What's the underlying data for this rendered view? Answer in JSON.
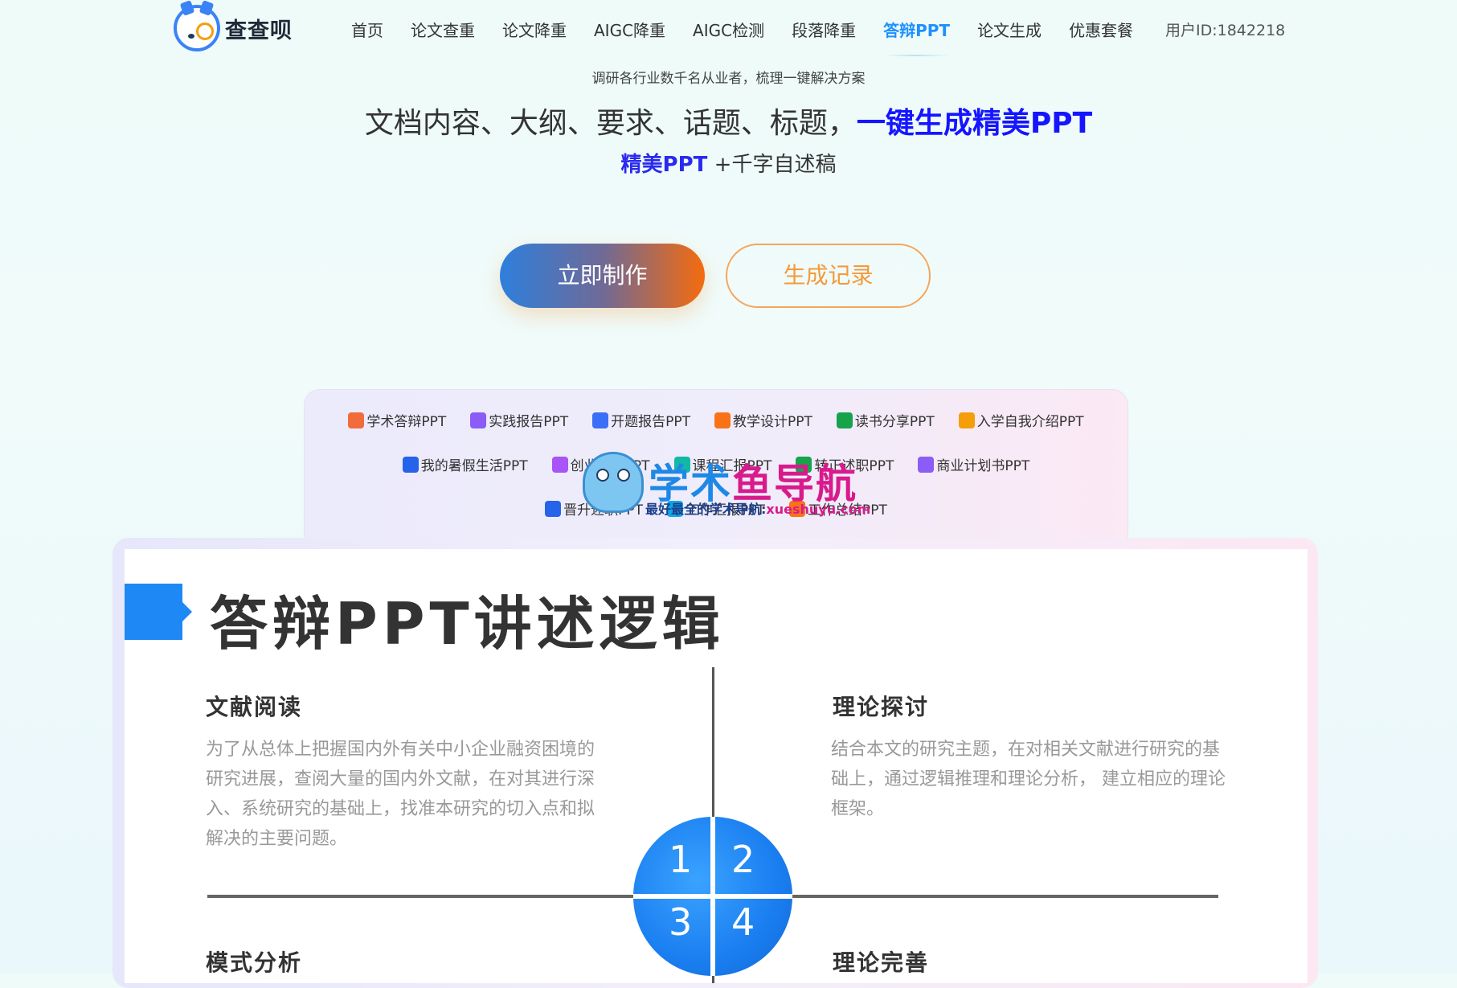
{
  "nav": {
    "logo_text": "查查呗",
    "items": [
      "首页",
      "论文查重",
      "论文降重",
      "AIGC降重",
      "AIGC检测",
      "段落降重",
      "答辩PPT",
      "论文生成",
      "优惠套餐"
    ],
    "active_index": 6,
    "user_id": "用户ID:1842218"
  },
  "hero": {
    "eyebrow": "调研各行业数千名从业者，梳理一键解决方案",
    "headline_plain": "文档内容、大纲、要求、话题、标题，",
    "headline_highlight": "一键生成精美PPT",
    "sub_highlight": "精美PPT",
    "sub_plain": " +千字自述稿",
    "primary_button": "立即制作",
    "secondary_button": "生成记录"
  },
  "categories": {
    "row1": [
      {
        "label": "学术答辩PPT",
        "icon": "book-icon",
        "color": "#f26b3a"
      },
      {
        "label": "实践报告PPT",
        "icon": "clipboard-icon",
        "color": "#8b5cf6"
      },
      {
        "label": "开题报告PPT",
        "icon": "document-search-icon",
        "color": "#3b6ff5"
      },
      {
        "label": "教学设计PPT",
        "icon": "teaching-icon",
        "color": "#f97316"
      },
      {
        "label": "读书分享PPT",
        "icon": "reading-icon",
        "color": "#16a34a"
      },
      {
        "label": "入学自我介绍PPT",
        "icon": "user-card-icon",
        "color": "#f59e0b"
      }
    ],
    "row2": [
      {
        "label": "我的暑假生活PPT",
        "icon": "summer-icon",
        "color": "#2563eb"
      },
      {
        "label": "创业计划PPT",
        "icon": "notepad-icon",
        "color": "#a855f7"
      },
      {
        "label": "课程汇报PPT",
        "icon": "presentation-icon",
        "color": "#14b8a6"
      },
      {
        "label": "转正述职PPT",
        "icon": "badge-icon",
        "color": "#16a34a"
      },
      {
        "label": "商业计划书PPT",
        "icon": "briefcase-icon",
        "color": "#8b5cf6"
      }
    ],
    "row3": [
      {
        "label": "晋升述职PPT",
        "icon": "chart-up-icon",
        "color": "#2563eb"
      },
      {
        "label": "工作汇报PPT",
        "icon": "report-icon",
        "color": "#0ea5e9"
      },
      {
        "label": "工作总结PPT",
        "icon": "summary-icon",
        "color": "#f97316"
      }
    ]
  },
  "watermark": {
    "title_a": "学术",
    "title_b": "鱼导航",
    "sub_a": "最好最全的学术导航:",
    "sub_b": "xueshuyu.com"
  },
  "slide": {
    "title": "答辩PPT讲述逻辑",
    "q1_head": "文献阅读",
    "q1_body": "为了从总体上把握国内外有关中小企业融资困境的研究进展，查阅大量的国内外文献，在对其进行深入、系统研究的基础上，找准本研究的切入点和拟解决的主要问题。",
    "q2_head": "理论探讨",
    "q2_body": "结合本文的研究主题，在对相关文献进行研究的基础上，通过逻辑推理和理论分析，  建立相应的理论框架。",
    "q3_head": "模式分析",
    "q4_head": "理论完善",
    "n1": "1",
    "n2": "2",
    "n3": "3",
    "n4": "4"
  }
}
